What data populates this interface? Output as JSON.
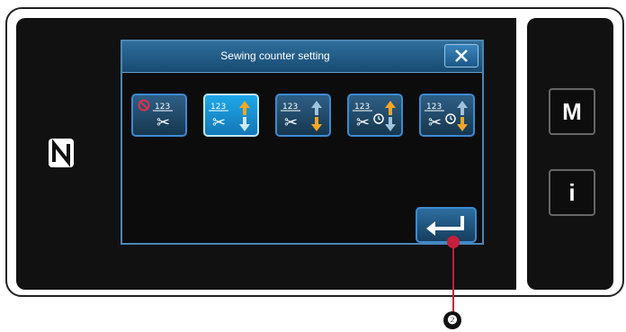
{
  "dialog": {
    "title": "Sewing counter setting",
    "close_icon": "close-icon",
    "options": [
      {
        "id": "counter-off",
        "icon": "no-counter-thread-trim-icon",
        "selected": false
      },
      {
        "id": "up-counter",
        "icon": "up-counter-thread-trim-icon",
        "selected": true
      },
      {
        "id": "down-counter",
        "icon": "down-counter-thread-trim-icon",
        "selected": false
      },
      {
        "id": "up-counter-time",
        "icon": "up-counter-time-icon",
        "selected": false
      },
      {
        "id": "down-counter-time",
        "icon": "down-counter-time-icon",
        "selected": false
      }
    ],
    "enter_icon": "enter-icon"
  },
  "side_panel": {
    "mode_label": "M",
    "info_label": "i"
  },
  "nfc_icon": "nfc-icon",
  "callout": {
    "number": "❷"
  },
  "colors": {
    "accent": "#3d8ad0",
    "selected": "#1ea8e8",
    "arrow_up_active": "#f5a623",
    "callout": "#c51f3a"
  }
}
